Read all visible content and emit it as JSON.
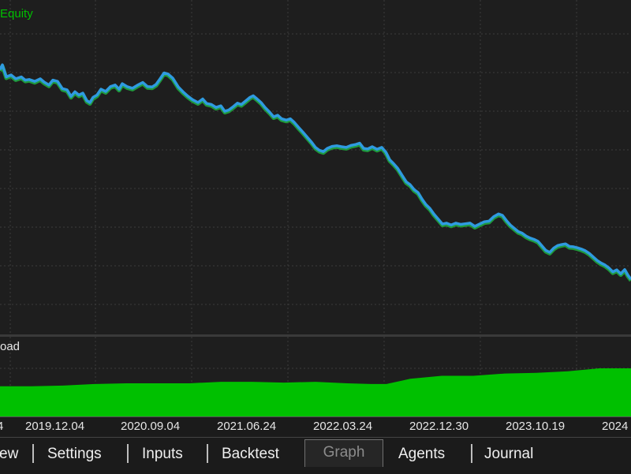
{
  "chart_data": [
    {
      "type": "line",
      "legend": [
        "Equity"
      ],
      "series": [
        {
          "name": "Equity",
          "color": "#2f9be0",
          "points": [
            [
              0,
              0.8
            ],
            [
              3,
              0.815
            ],
            [
              8,
              0.778
            ],
            [
              14,
              0.784
            ],
            [
              20,
              0.772
            ],
            [
              27,
              0.778
            ],
            [
              32,
              0.768
            ],
            [
              37,
              0.77
            ],
            [
              44,
              0.764
            ],
            [
              51,
              0.772
            ],
            [
              56,
              0.762
            ],
            [
              62,
              0.753
            ],
            [
              67,
              0.768
            ],
            [
              73,
              0.764
            ],
            [
              79,
              0.742
            ],
            [
              85,
              0.738
            ],
            [
              90,
              0.718
            ],
            [
              95,
              0.732
            ],
            [
              100,
              0.722
            ],
            [
              105,
              0.728
            ],
            [
              110,
              0.705
            ],
            [
              114,
              0.699
            ],
            [
              118,
              0.715
            ],
            [
              123,
              0.722
            ],
            [
              128,
              0.74
            ],
            [
              134,
              0.733
            ],
            [
              140,
              0.748
            ],
            [
              146,
              0.753
            ],
            [
              151,
              0.74
            ],
            [
              155,
              0.757
            ],
            [
              161,
              0.748
            ],
            [
              168,
              0.743
            ],
            [
              174,
              0.752
            ],
            [
              181,
              0.761
            ],
            [
              187,
              0.748
            ],
            [
              193,
              0.747
            ],
            [
              198,
              0.755
            ],
            [
              203,
              0.772
            ],
            [
              208,
              0.79
            ],
            [
              213,
              0.787
            ],
            [
              219,
              0.774
            ],
            [
              226,
              0.747
            ],
            [
              232,
              0.732
            ],
            [
              238,
              0.719
            ],
            [
              244,
              0.708
            ],
            [
              251,
              0.699
            ],
            [
              257,
              0.71
            ],
            [
              262,
              0.696
            ],
            [
              268,
              0.693
            ],
            [
              274,
              0.684
            ],
            [
              280,
              0.689
            ],
            [
              285,
              0.672
            ],
            [
              290,
              0.676
            ],
            [
              296,
              0.687
            ],
            [
              301,
              0.697
            ],
            [
              306,
              0.693
            ],
            [
              311,
              0.703
            ],
            [
              317,
              0.715
            ],
            [
              321,
              0.72
            ],
            [
              326,
              0.71
            ],
            [
              331,
              0.699
            ],
            [
              336,
              0.684
            ],
            [
              342,
              0.669
            ],
            [
              347,
              0.655
            ],
            [
              352,
              0.66
            ],
            [
              357,
              0.649
            ],
            [
              363,
              0.645
            ],
            [
              368,
              0.649
            ],
            [
              373,
              0.638
            ],
            [
              378,
              0.624
            ],
            [
              384,
              0.608
            ],
            [
              390,
              0.591
            ],
            [
              395,
              0.577
            ],
            [
              400,
              0.561
            ],
            [
              405,
              0.552
            ],
            [
              410,
              0.548
            ],
            [
              415,
              0.558
            ],
            [
              421,
              0.564
            ],
            [
              427,
              0.566
            ],
            [
              433,
              0.563
            ],
            [
              439,
              0.561
            ],
            [
              445,
              0.567
            ],
            [
              451,
              0.57
            ],
            [
              456,
              0.574
            ],
            [
              461,
              0.558
            ],
            [
              466,
              0.556
            ],
            [
              472,
              0.563
            ],
            [
              478,
              0.555
            ],
            [
              484,
              0.561
            ],
            [
              489,
              0.547
            ],
            [
              494,
              0.523
            ],
            [
              499,
              0.511
            ],
            [
              504,
              0.497
            ],
            [
              510,
              0.474
            ],
            [
              515,
              0.455
            ],
            [
              520,
              0.446
            ],
            [
              525,
              0.431
            ],
            [
              530,
              0.422
            ],
            [
              535,
              0.402
            ],
            [
              540,
              0.385
            ],
            [
              545,
              0.373
            ],
            [
              550,
              0.356
            ],
            [
              555,
              0.342
            ],
            [
              561,
              0.325
            ],
            [
              566,
              0.328
            ],
            [
              572,
              0.322
            ],
            [
              578,
              0.328
            ],
            [
              584,
              0.324
            ],
            [
              590,
              0.326
            ],
            [
              596,
              0.328
            ],
            [
              602,
              0.318
            ],
            [
              608,
              0.325
            ],
            [
              614,
              0.332
            ],
            [
              620,
              0.334
            ],
            [
              626,
              0.348
            ],
            [
              632,
              0.356
            ],
            [
              637,
              0.352
            ],
            [
              642,
              0.336
            ],
            [
              647,
              0.322
            ],
            [
              652,
              0.312
            ],
            [
              657,
              0.302
            ],
            [
              662,
              0.297
            ],
            [
              667,
              0.288
            ],
            [
              672,
              0.282
            ],
            [
              677,
              0.278
            ],
            [
              682,
              0.272
            ],
            [
              687,
              0.258
            ],
            [
              692,
              0.244
            ],
            [
              697,
              0.238
            ],
            [
              702,
              0.251
            ],
            [
              707,
              0.259
            ],
            [
              712,
              0.262
            ],
            [
              717,
              0.264
            ],
            [
              722,
              0.256
            ],
            [
              727,
              0.255
            ],
            [
              732,
              0.252
            ],
            [
              737,
              0.248
            ],
            [
              742,
              0.243
            ],
            [
              747,
              0.235
            ],
            [
              752,
              0.224
            ],
            [
              757,
              0.213
            ],
            [
              762,
              0.205
            ],
            [
              767,
              0.199
            ],
            [
              772,
              0.19
            ],
            [
              777,
              0.178
            ],
            [
              782,
              0.184
            ],
            [
              787,
              0.172
            ],
            [
              792,
              0.185
            ],
            [
              796,
              0.168
            ],
            [
              800,
              0.155
            ]
          ]
        }
      ],
      "grid": true
    },
    {
      "type": "area",
      "legend": [
        "oad"
      ],
      "series": [
        {
          "name": "oad",
          "color": "#00c000",
          "points": [
            [
              0,
              0.36
            ],
            [
              40,
              0.36
            ],
            [
              80,
              0.37
            ],
            [
              120,
              0.39
            ],
            [
              160,
              0.4
            ],
            [
              200,
              0.4
            ],
            [
              240,
              0.4
            ],
            [
              280,
              0.42
            ],
            [
              320,
              0.42
            ],
            [
              360,
              0.41
            ],
            [
              400,
              0.42
            ],
            [
              440,
              0.4
            ],
            [
              470,
              0.39
            ],
            [
              490,
              0.39
            ],
            [
              520,
              0.46
            ],
            [
              560,
              0.5
            ],
            [
              600,
              0.5
            ],
            [
              640,
              0.53
            ],
            [
              680,
              0.54
            ],
            [
              720,
              0.56
            ],
            [
              760,
              0.6
            ],
            [
              800,
              0.6
            ]
          ]
        }
      ],
      "grid": true
    }
  ],
  "xaxis": {
    "labels": [
      "4",
      "2019.12.04",
      "2020.09.04",
      "2021.06.24",
      "2022.03.24",
      "2022.12.30",
      "2023.10.19",
      "2024"
    ]
  },
  "tabs": [
    {
      "label": "ew",
      "active": false
    },
    {
      "label": "Settings",
      "active": false
    },
    {
      "label": "Inputs",
      "active": false
    },
    {
      "label": "Backtest",
      "active": false
    },
    {
      "label": "Graph",
      "active": true
    },
    {
      "label": "Agents",
      "active": false
    },
    {
      "label": "Journal",
      "active": false
    }
  ],
  "colors": {
    "background": "#1e1e1e",
    "grid": "#3c3c3c",
    "equity_line": "#2f9be0",
    "equity_shadow": "#1f9a3c",
    "legend_text": "#00c000",
    "drawdown_fill": "#00c000",
    "axis_text": "#e6e6e6"
  }
}
